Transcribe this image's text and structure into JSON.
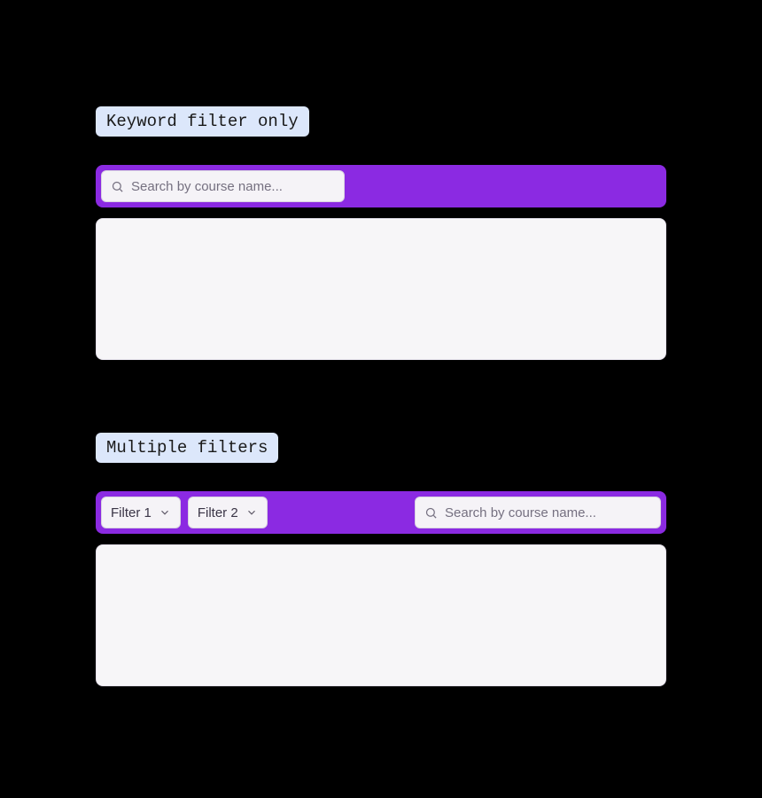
{
  "colors": {
    "toolbar_bg": "#8b2ae2",
    "tag_bg": "#dce7fb",
    "panel_bg": "#f7f6f8"
  },
  "section1": {
    "tag": "Keyword filter only",
    "search_placeholder": "Search by course name..."
  },
  "section2": {
    "tag": "Multiple filters",
    "filters": [
      {
        "label": "Filter 1"
      },
      {
        "label": "Filter 2"
      }
    ],
    "search_placeholder": "Search by course name..."
  }
}
